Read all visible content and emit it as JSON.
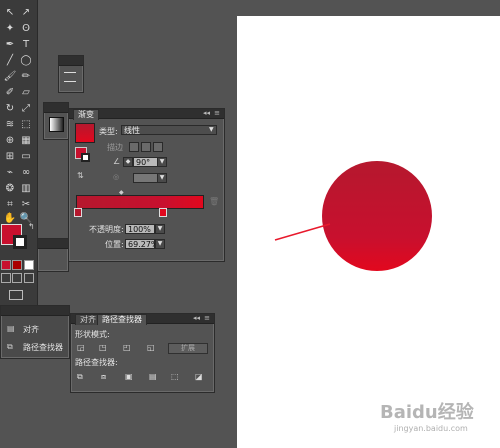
{
  "colors": {
    "app_bg": "#535353",
    "artboard": "#ffffff",
    "accent_red": "#c8102e",
    "arrow": "#e8192c"
  },
  "gradient_panel": {
    "tab": "渐变",
    "type_label": "类型:",
    "type_value": "线性",
    "stroke_label": "描边",
    "angle_value": "90°",
    "opacity_label": "不透明度:",
    "opacity_value": "100%",
    "location_label": "位置:",
    "location_value": "69.27%"
  },
  "pathfinder_panel": {
    "tab_align": "对齐",
    "tab_pathfinder": "路径查找器",
    "shape_modes_label": "形状模式:",
    "expand_button": "扩展",
    "pathfinders_label": "路径查找器:"
  },
  "left_panel": {
    "item_align": "对齐",
    "item_pathfinder": "路径查找器"
  },
  "watermark": {
    "text": "Baidu经验",
    "url": "jingyan.baidu.com"
  }
}
